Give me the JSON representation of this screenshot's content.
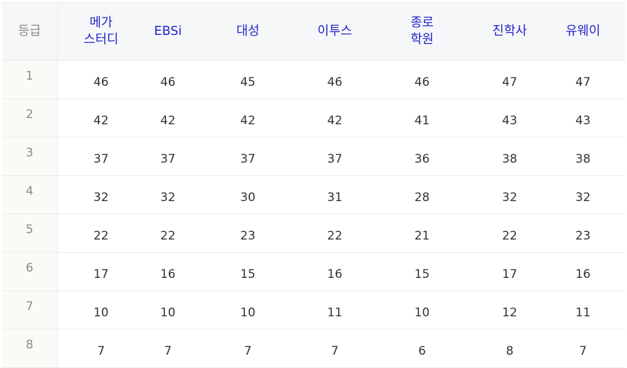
{
  "table": {
    "grade_header": "등급",
    "columns": [
      {
        "line1": "메가",
        "line2": "스터디"
      },
      {
        "line1": "EBSi",
        "line2": ""
      },
      {
        "line1": "대성",
        "line2": ""
      },
      {
        "line1": "이투스",
        "line2": ""
      },
      {
        "line1": "종로",
        "line2": "학원"
      },
      {
        "line1": "진학사",
        "line2": ""
      },
      {
        "line1": "유웨이",
        "line2": ""
      }
    ],
    "rows": [
      {
        "grade": "1",
        "values": [
          "46",
          "46",
          "45",
          "46",
          "46",
          "47",
          "47"
        ]
      },
      {
        "grade": "2",
        "values": [
          "42",
          "42",
          "42",
          "42",
          "41",
          "43",
          "43"
        ]
      },
      {
        "grade": "3",
        "values": [
          "37",
          "37",
          "37",
          "37",
          "36",
          "38",
          "38"
        ]
      },
      {
        "grade": "4",
        "values": [
          "32",
          "32",
          "30",
          "31",
          "28",
          "32",
          "32"
        ]
      },
      {
        "grade": "5",
        "values": [
          "22",
          "22",
          "23",
          "22",
          "21",
          "22",
          "23"
        ]
      },
      {
        "grade": "6",
        "values": [
          "17",
          "16",
          "15",
          "16",
          "15",
          "17",
          "16"
        ]
      },
      {
        "grade": "7",
        "values": [
          "10",
          "10",
          "10",
          "11",
          "10",
          "12",
          "11"
        ]
      },
      {
        "grade": "8",
        "values": [
          "7",
          "7",
          "7",
          "7",
          "6",
          "8",
          "7"
        ]
      }
    ]
  }
}
